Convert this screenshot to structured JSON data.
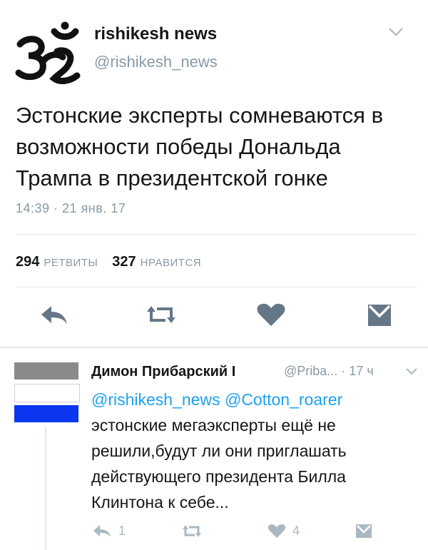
{
  "tweet": {
    "account_name": "rishikesh news",
    "handle": "@rishikesh_news",
    "text": "Эстонские эксперты сомневаются в возможности победы Дональда Трампа в президентской гонке",
    "timestamp": "14:39 · 21 янв. 17",
    "retweets_count": "294",
    "retweets_label": "РЕТВИТЫ",
    "likes_count": "327",
    "likes_label": "НРАВИТСЯ"
  },
  "reply": {
    "author_name": "Димон Прибарский I",
    "handle": "@Priba...",
    "time": "· 17 ч",
    "mentions": "@rishikesh_news @Cotton_roarer",
    "text": "эстонские мегаэксперты ещё не решили,будут ли они приглашать действующего президента Билла Клинтона к себе...",
    "reply_count": "1",
    "like_count": "4"
  },
  "colors": {
    "muted": "#8899a6",
    "link": "#1da1f2",
    "icon": "#657786",
    "flag_blue": "#0a36f0"
  },
  "icons": [
    "om-symbol-avatar",
    "chevron-down-icon",
    "reply-icon",
    "retweet-icon",
    "heart-icon",
    "dm-icon"
  ]
}
